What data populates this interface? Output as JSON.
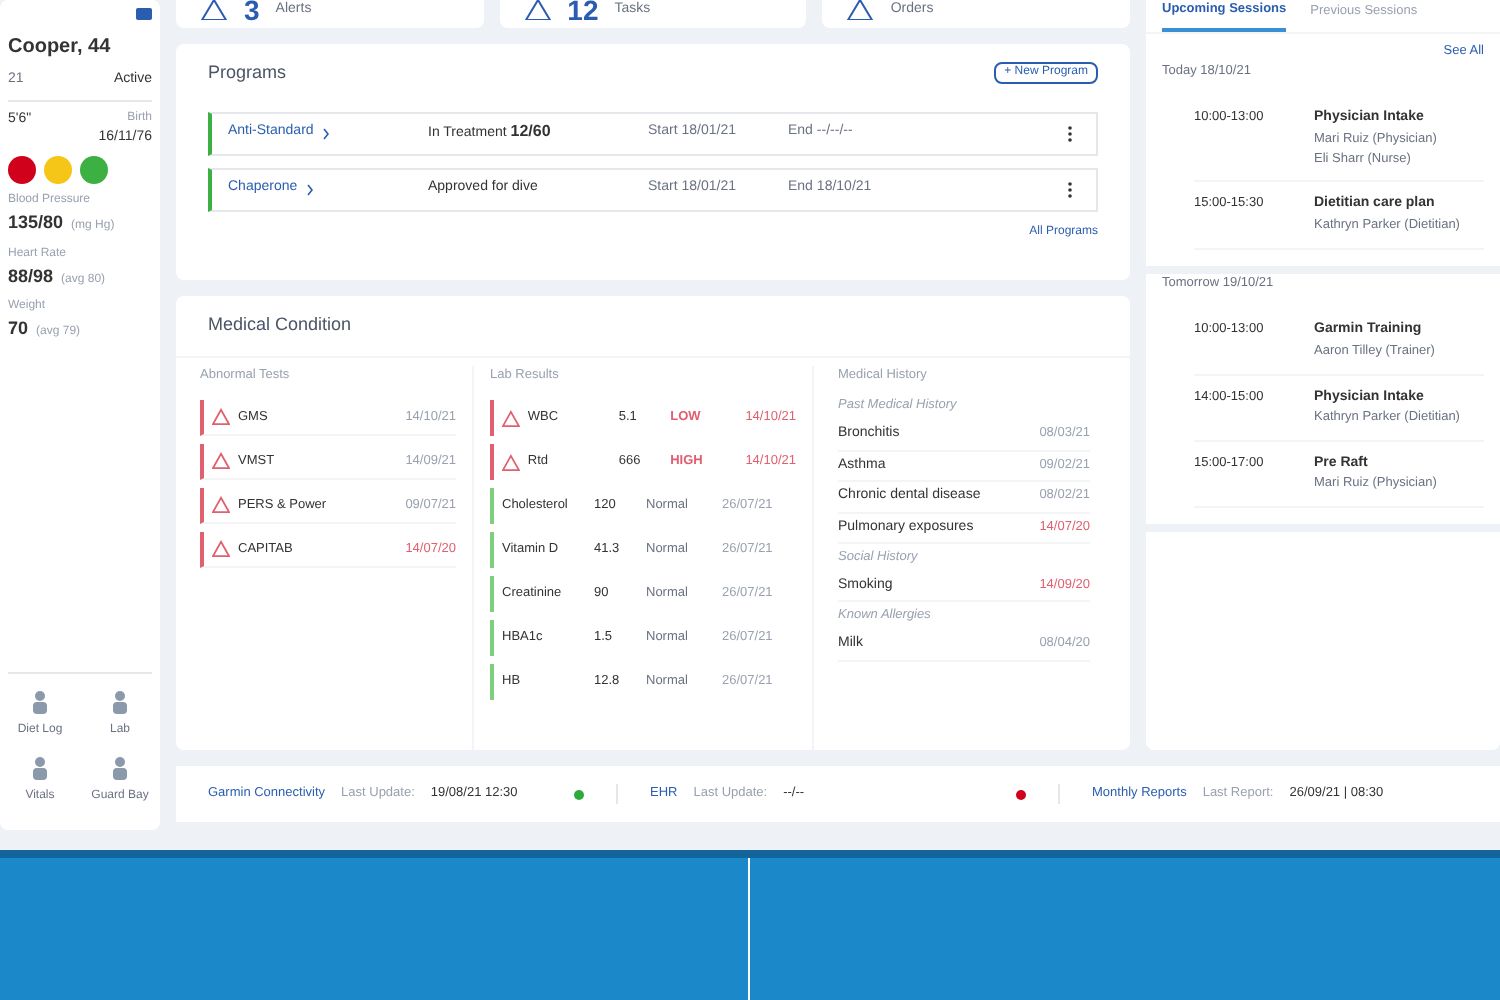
{
  "patient": {
    "name": "Cooper, 44",
    "id": "21",
    "status": "Active",
    "height": "5'6\"",
    "birth_label": "Birth",
    "birth": "16/11/76",
    "badges": [
      {
        "color": "#d0021b"
      },
      {
        "color": "#f5c518"
      },
      {
        "color": "#3cb043"
      }
    ],
    "vitals": [
      {
        "label": "Blood Pressure",
        "value": "135/80",
        "unit": "(mg Hg)"
      },
      {
        "label": "Heart Rate",
        "value": "88/98",
        "unit": "(avg 80)"
      },
      {
        "label": "Weight",
        "value": "70",
        "unit": "(avg 79)"
      }
    ],
    "actions": [
      {
        "label": "Diet Log"
      },
      {
        "label": "Lab"
      },
      {
        "label": "Vitals"
      },
      {
        "label": "Guard Bay"
      }
    ]
  },
  "summary": [
    {
      "count": "3",
      "label": "Alerts"
    },
    {
      "count": "12",
      "label": "Tasks"
    },
    {
      "label": "Orders"
    }
  ],
  "programs": {
    "title": "Programs",
    "new_button": "+ New Program",
    "link": "All Programs",
    "items": [
      {
        "name": "Anti-Standard",
        "status_label": "In Treatment",
        "status_value": "12/60",
        "start_label": "Start",
        "start": "18/01/21",
        "end_label": "End",
        "end": "--/--/--"
      },
      {
        "name": "Chaperone",
        "status_label": "Approved for dive",
        "start_label": "Start",
        "start": "18/01/21",
        "end_label": "End",
        "end": "18/10/21"
      }
    ]
  },
  "medical": {
    "title": "Medical Condition",
    "abnormal": {
      "title": "Abnormal Tests",
      "items": [
        {
          "name": "GMS",
          "date": "14/10/21",
          "alert": false
        },
        {
          "name": "VMST",
          "date": "14/09/21",
          "alert": false
        },
        {
          "name": "PERS & Power",
          "date": "09/07/21",
          "alert": false
        },
        {
          "name": "CAPITAB",
          "date": "14/07/20",
          "alert": true
        }
      ]
    },
    "lab": {
      "title": "Lab Results",
      "items": [
        {
          "name": "WBC",
          "value": "5.1",
          "result": "LOW",
          "date": "14/10/21",
          "abnormal": true
        },
        {
          "name": "Rtd",
          "value": "666",
          "result": "HIGH",
          "date": "14/10/21",
          "abnormal": true
        },
        {
          "name": "Cholesterol",
          "value": "120",
          "result": "Normal",
          "date": "26/07/21",
          "abnormal": false
        },
        {
          "name": "Vitamin D",
          "value": "41.3",
          "result": "Normal",
          "date": "26/07/21",
          "abnormal": false
        },
        {
          "name": "Creatinine",
          "value": "90",
          "result": "Normal",
          "date": "26/07/21",
          "abnormal": false
        },
        {
          "name": "HBA1c",
          "value": "1.5",
          "result": "Normal",
          "date": "26/07/21",
          "abnormal": false
        },
        {
          "name": "HB",
          "value": "12.8",
          "result": "Normal",
          "date": "26/07/21",
          "abnormal": false
        }
      ]
    },
    "history": {
      "title": "Medical History",
      "groups": [
        {
          "title": "Past Medical History",
          "items": [
            {
              "name": "Bronchitis",
              "date": "08/03/21",
              "alert": false
            },
            {
              "name": "Asthma",
              "date": "09/02/21",
              "alert": false
            },
            {
              "name": "Chronic dental disease",
              "date": "08/02/21",
              "alert": false
            },
            {
              "name": "Pulmonary exposures",
              "date": "14/07/20",
              "alert": true
            }
          ]
        },
        {
          "title": "Social History",
          "items": [
            {
              "name": "Smoking",
              "date": "14/09/20",
              "alert": true
            }
          ]
        },
        {
          "title": "Known Allergies",
          "items": [
            {
              "name": "Milk",
              "date": "08/04/20",
              "alert": false
            }
          ]
        }
      ]
    }
  },
  "status_bar": [
    {
      "name": "Garmin Connectivity",
      "label": "Last Update:",
      "value": "19/08/21 12:30",
      "color": "#2eaa3c"
    },
    {
      "name": "EHR",
      "label": "Last Update:",
      "value": "--/--",
      "color": "#d0021b"
    },
    {
      "name": "Monthly Reports",
      "label": "Last Report:",
      "value": "26/09/21 | 08:30"
    }
  ],
  "sessions": {
    "tabs": [
      {
        "label": "Upcoming Sessions",
        "selected": true
      },
      {
        "label": "Previous Sessions",
        "selected": false
      }
    ],
    "link": "See All",
    "days": [
      {
        "title": "Today 18/10/21",
        "items": [
          {
            "time": "10:00-13:00",
            "title": "Physician Intake",
            "people": [
              "Mari Ruiz (Physician)",
              "Eli Sharr (Nurse)"
            ]
          },
          {
            "time": "15:00-15:30",
            "title": "Dietitian care plan",
            "people": [
              "Kathryn Parker (Dietitian)"
            ]
          }
        ]
      },
      {
        "title": "Tomorrow 19/10/21",
        "items": [
          {
            "time": "10:00-13:00",
            "title": "Garmin Training",
            "people": [
              "Aaron Tilley (Trainer)"
            ]
          },
          {
            "time": "14:00-15:00",
            "title": "Physician Intake",
            "people": [
              "Kathryn Parker (Dietitian)"
            ]
          },
          {
            "time": "15:00-17:00",
            "title": "Pre Raft",
            "people": [
              "Mari Ruiz (Physician)"
            ]
          }
        ]
      }
    ]
  }
}
